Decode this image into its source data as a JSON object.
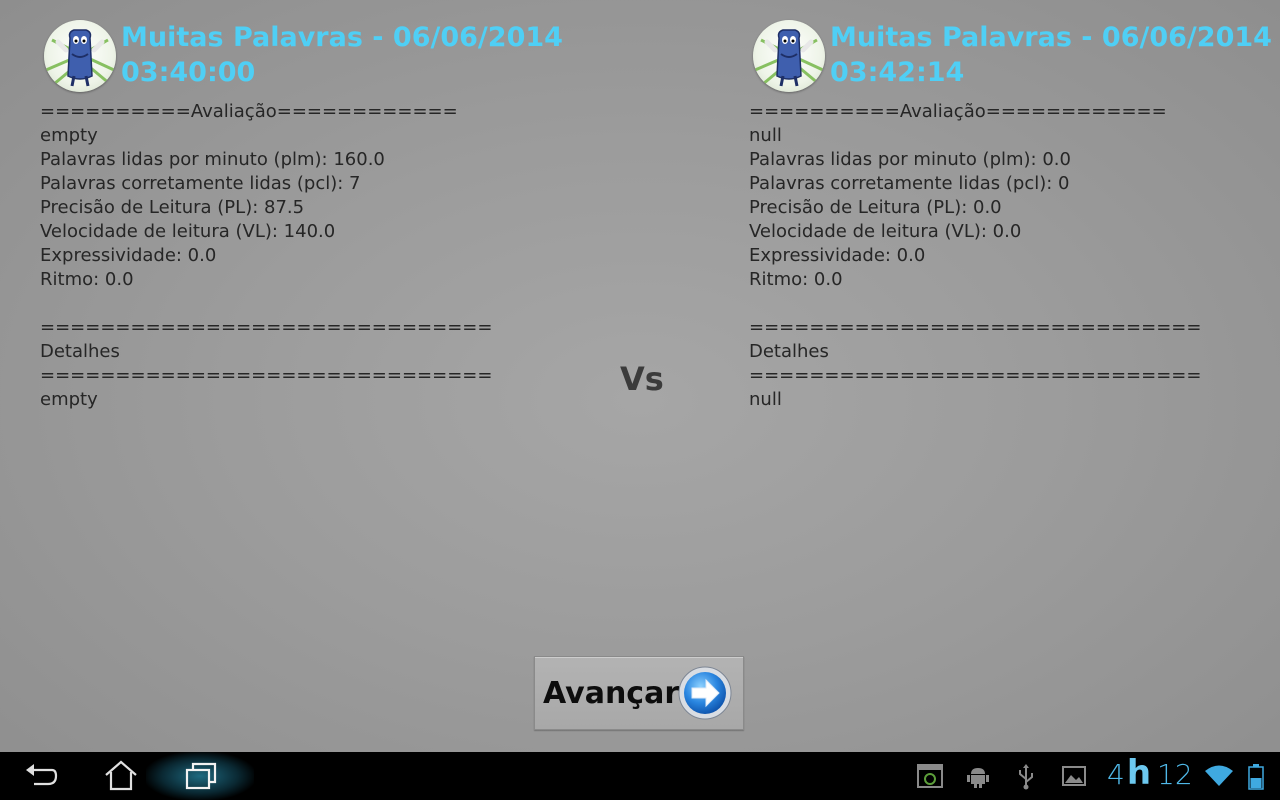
{
  "left": {
    "title_line1": "Muitas Palavras - 06/06/2014",
    "title_line2": "03:40:00",
    "lines": [
      "==========Avaliação============",
      "empty",
      "Palavras lidas por minuto (plm): 160.0",
      "Palavras corretamente lidas (pcl): 7",
      "Precisão de Leitura (PL): 87.5",
      "Velocidade de leitura (VL): 140.0",
      "Expressividade: 0.0",
      "Ritmo: 0.0",
      "",
      "==============================",
      "Detalhes",
      "==============================",
      "empty"
    ]
  },
  "right": {
    "title_line1": "Muitas Palavras - 06/06/2014",
    "title_line2": "03:42:14",
    "lines": [
      "==========Avaliação============",
      "null",
      "Palavras lidas por minuto (plm): 0.0",
      "Palavras corretamente lidas (pcl): 0",
      "Precisão de Leitura (PL): 0.0",
      "Velocidade de leitura (VL): 0.0",
      "Expressividade: 0.0",
      "Ritmo: 0.0",
      "",
      "==============================",
      "Detalhes",
      "==============================",
      "null"
    ]
  },
  "vs_label": "Vs",
  "advance_button": {
    "label": "Avançar",
    "icon": "arrow-right-icon"
  },
  "navbar": {
    "back": "back-icon",
    "home": "home-icon",
    "recents": "recent-apps-icon"
  },
  "status": {
    "clock_hours": "4",
    "clock_symbol": "h",
    "clock_minutes": "12",
    "icons": [
      "screenshot-icon",
      "android-debug-icon",
      "usb-icon",
      "image-icon",
      "wifi-icon",
      "battery-icon"
    ]
  },
  "colors": {
    "title": "#4fcff5",
    "text": "#262626",
    "clock": "#4fb8e8"
  }
}
